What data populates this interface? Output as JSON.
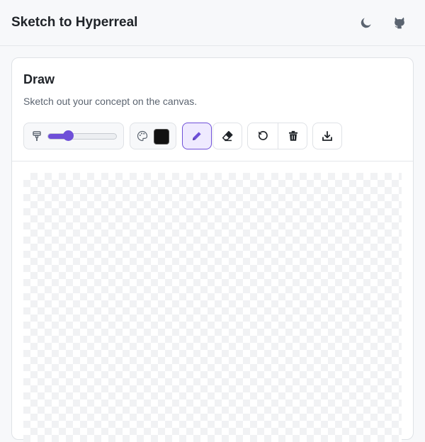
{
  "app": {
    "title": "Sketch to Hyperreal"
  },
  "header": {
    "icons": [
      "moon-icon",
      "github-icon"
    ]
  },
  "draw_panel": {
    "title": "Draw",
    "description": "Sketch out your concept on the canvas.",
    "brush_size": {
      "value": 30,
      "max": 100
    },
    "brush_color": "#111111",
    "active_tool": "pencil",
    "tools": [
      "brush-size-icon",
      "palette-icon",
      "pencil-icon",
      "eraser-icon",
      "undo-icon",
      "trash-icon",
      "download-icon"
    ]
  },
  "colors": {
    "accent": "#6e4fd8",
    "accent_bg": "#efeaff"
  }
}
